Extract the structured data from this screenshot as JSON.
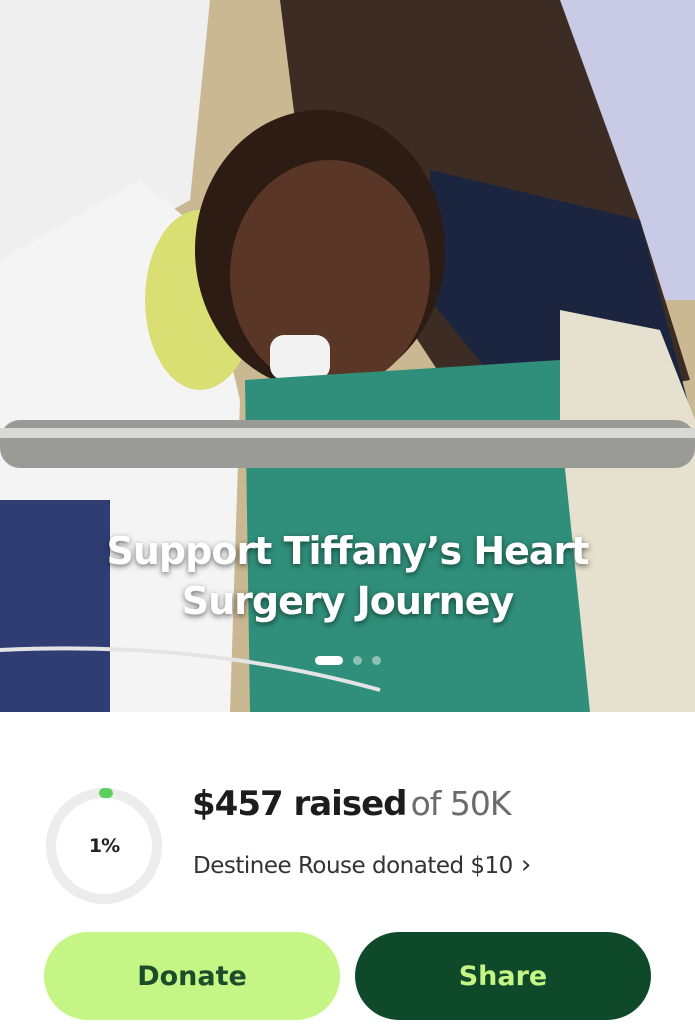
{
  "hero": {
    "title": "Support Tiffany’s Heart\nSurgery Journey",
    "carousel_dots": 3,
    "active_dot": 0
  },
  "progress": {
    "percent_label": "1%",
    "percent_value": 0.01,
    "raised_amount": "$457 raised",
    "goal_text": "of 50K",
    "latest_donation": "Destinee Rouse donated $10"
  },
  "actions": {
    "donate_label": "Donate",
    "share_label": "Share"
  },
  "colors": {
    "ring_track": "#ececec",
    "ring_progress": "#5bd15b",
    "donate_bg": "#c5f585",
    "share_bg": "#0e4a2a"
  }
}
